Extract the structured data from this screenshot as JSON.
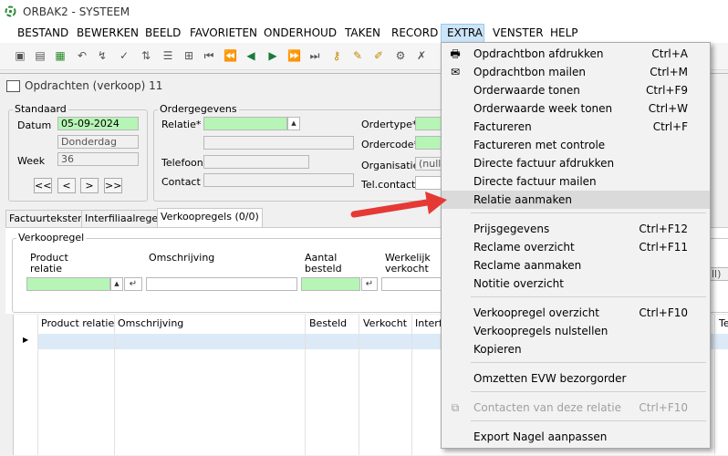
{
  "app": {
    "title": "ORBAK2 - SYSTEEM"
  },
  "menubar": {
    "items": [
      "BESTAND",
      "BEWERKEN",
      "BEELD",
      "FAVORIETEN",
      "ONDERHOUD",
      "TAKEN",
      "RECORD",
      "EXTRA",
      "VENSTER",
      "HELP"
    ]
  },
  "child": {
    "title": "Opdrachten (verkoop) 11"
  },
  "standaard": {
    "legend": "Standaard",
    "datum_label": "Datum",
    "datum_value": "05-09-2024",
    "day_value": "Donderdag",
    "week_label": "Week",
    "week_value": "36",
    "nav": [
      "<<",
      "<",
      ">",
      ">>"
    ]
  },
  "ordergegevens": {
    "legend": "Ordergegevens",
    "relatie_label": "Relatie*",
    "telefoon_label": "Telefoon",
    "contact_label": "Contact",
    "ordertype_label": "Ordertype*",
    "ordercode_label": "Ordercode*",
    "organisatie_label": "Organisatie",
    "organisatie_value": "(null)",
    "telcontact_label": "Tel.contact",
    "right_partial_value": "ll)"
  },
  "tabs": [
    "Factuurteksten",
    "Interfiliaalregels",
    "Verkoopregels (0/0)"
  ],
  "verkoopregel": {
    "legend": "Verkoopregel",
    "col1": "Product\nrelatie",
    "col1a": "Product",
    "col1b": "relatie",
    "col2": "Omschrijving",
    "col3a": "Aantal",
    "col3b": "besteld",
    "col4a": "Werkelijk",
    "col4b": "verkocht"
  },
  "grid": {
    "headers": [
      "Product relatie",
      "Omschrijving",
      "Besteld",
      "Verkocht",
      "Interfi",
      "Te"
    ]
  },
  "context_menu": {
    "items": [
      {
        "label": "Opdrachtbon afdrukken",
        "shortcut": "Ctrl+A",
        "icon": "printer-icon"
      },
      {
        "label": "Opdrachtbon mailen",
        "shortcut": "Ctrl+M",
        "icon": "envelope-icon"
      },
      {
        "label": "Orderwaarde tonen",
        "shortcut": "Ctrl+F9"
      },
      {
        "label": "Orderwaarde week tonen",
        "shortcut": "Ctrl+W"
      },
      {
        "label": "Factureren",
        "shortcut": "Ctrl+F"
      },
      {
        "label": "Factureren met controle",
        "shortcut": ""
      },
      {
        "label": "Directe factuur afdrukken",
        "shortcut": ""
      },
      {
        "label": "Directe factuur mailen",
        "shortcut": ""
      },
      {
        "label": "Relatie aanmaken",
        "shortcut": ""
      },
      {
        "label": "Prijsgegevens",
        "shortcut": "Ctrl+F12"
      },
      {
        "label": "Reclame overzicht",
        "shortcut": "Ctrl+F11"
      },
      {
        "label": "Reclame aanmaken",
        "shortcut": ""
      },
      {
        "label": "Notitie overzicht",
        "shortcut": ""
      },
      {
        "label": "Verkoopregel overzicht",
        "shortcut": "Ctrl+F10"
      },
      {
        "label": "Verkoopregels nulstellen",
        "shortcut": ""
      },
      {
        "label": "Kopieren",
        "shortcut": ""
      },
      {
        "label": "Omzetten EVW bezorgorder",
        "shortcut": ""
      },
      {
        "label": "Contacten van deze relatie",
        "shortcut": "Ctrl+F10",
        "icon": "contacts-icon"
      },
      {
        "label": "Export Nagel aanpassen",
        "shortcut": ""
      }
    ]
  },
  "colors": {
    "field_green": "#b6f5b6",
    "arrow_red": "#e53935",
    "menu_highlight": "#cce4f7"
  }
}
